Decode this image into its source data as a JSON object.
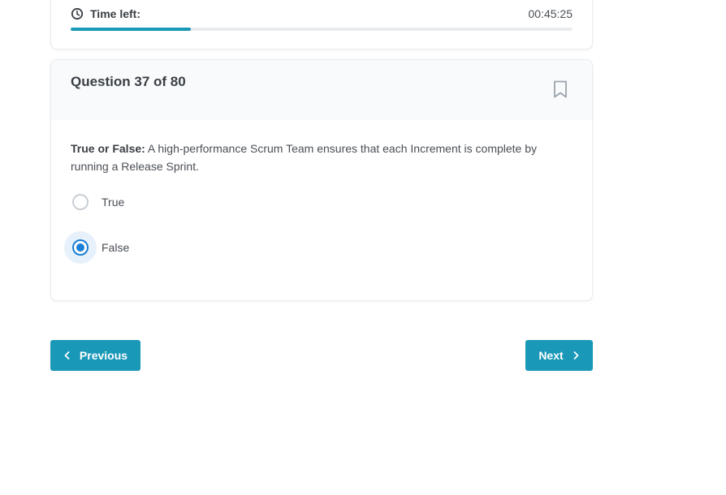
{
  "timer": {
    "label": "Time left:",
    "value": "00:45:25",
    "progress_fraction": 0.24,
    "icon": "clock-icon"
  },
  "question": {
    "title": "Question 37 of 80",
    "prefix": "True or False:",
    "text": " A high-performance Scrum Team ensures that each Increment is complete by running a Release Sprint.",
    "bookmark_icon": "bookmark-icon",
    "options": [
      {
        "label": "True",
        "selected": false
      },
      {
        "label": "False",
        "selected": true
      }
    ]
  },
  "nav": {
    "previous_label": "Previous",
    "next_label": "Next"
  },
  "colors": {
    "accent": "#1a98b8",
    "radio_selected": "#1a7fd6"
  }
}
